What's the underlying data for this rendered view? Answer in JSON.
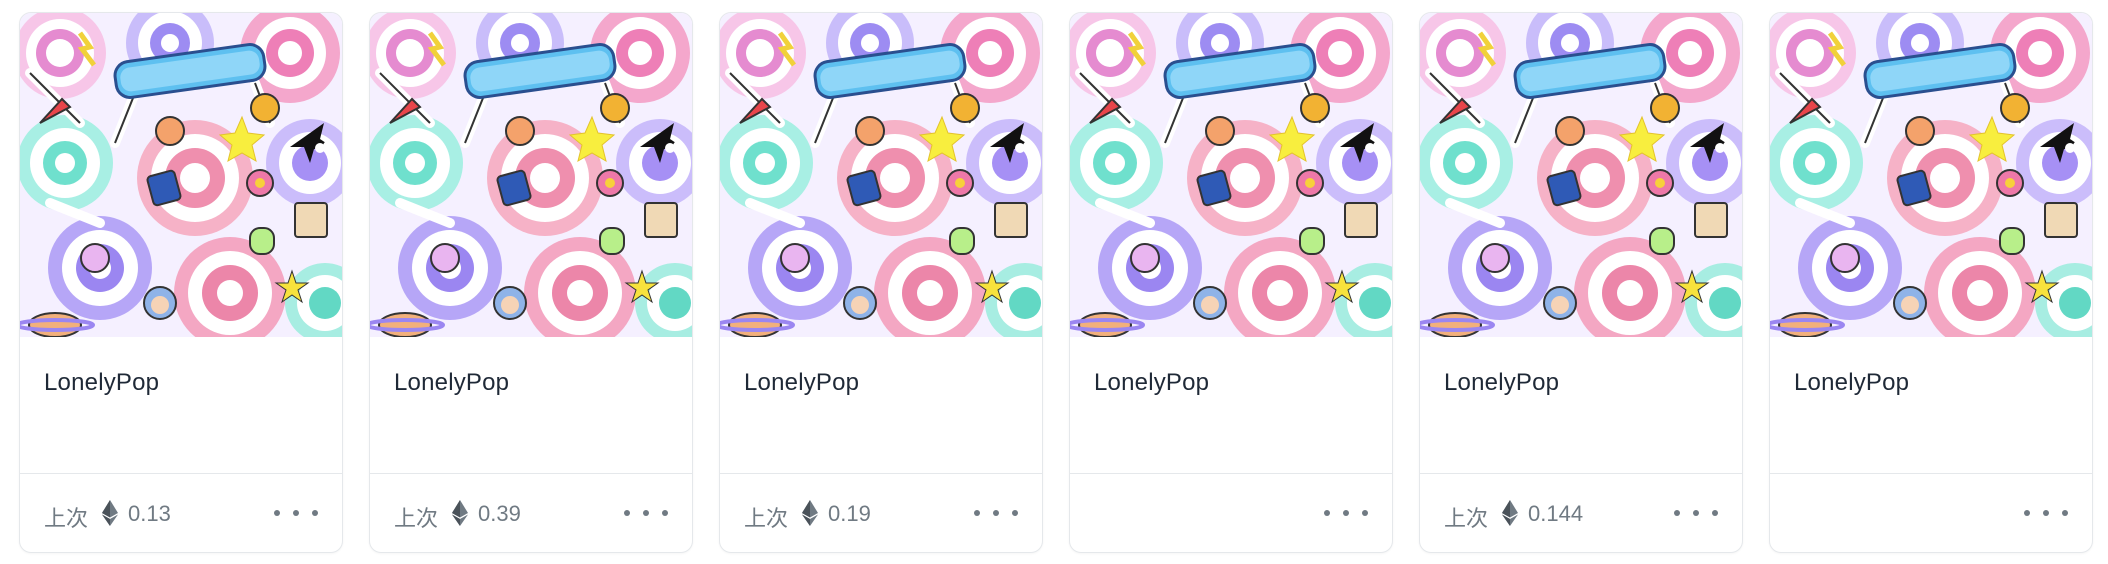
{
  "colors": {
    "border": "#e5e8eb",
    "text_primary": "#1f2937",
    "text_secondary": "#707a83"
  },
  "cards": [
    {
      "name": "LonelyPop",
      "last_label": "上次",
      "price": "0.13",
      "more_icon": "ellipsis-icon",
      "currency_icon": "ethereum-icon"
    },
    {
      "name": "LonelyPop",
      "last_label": "上次",
      "price": "0.39",
      "more_icon": "ellipsis-icon",
      "currency_icon": "ethereum-icon"
    },
    {
      "name": "LonelyPop",
      "last_label": "上次",
      "price": "0.19",
      "more_icon": "ellipsis-icon",
      "currency_icon": "ethereum-icon"
    },
    {
      "name": "LonelyPop",
      "last_label": "",
      "price": "",
      "more_icon": "ellipsis-icon",
      "currency_icon": ""
    },
    {
      "name": "LonelyPop",
      "last_label": "上次",
      "price": "0.144",
      "more_icon": "ellipsis-icon",
      "currency_icon": "ethereum-icon"
    },
    {
      "name": "LonelyPop",
      "last_label": "",
      "price": "",
      "more_icon": "ellipsis-icon",
      "currency_icon": ""
    }
  ]
}
